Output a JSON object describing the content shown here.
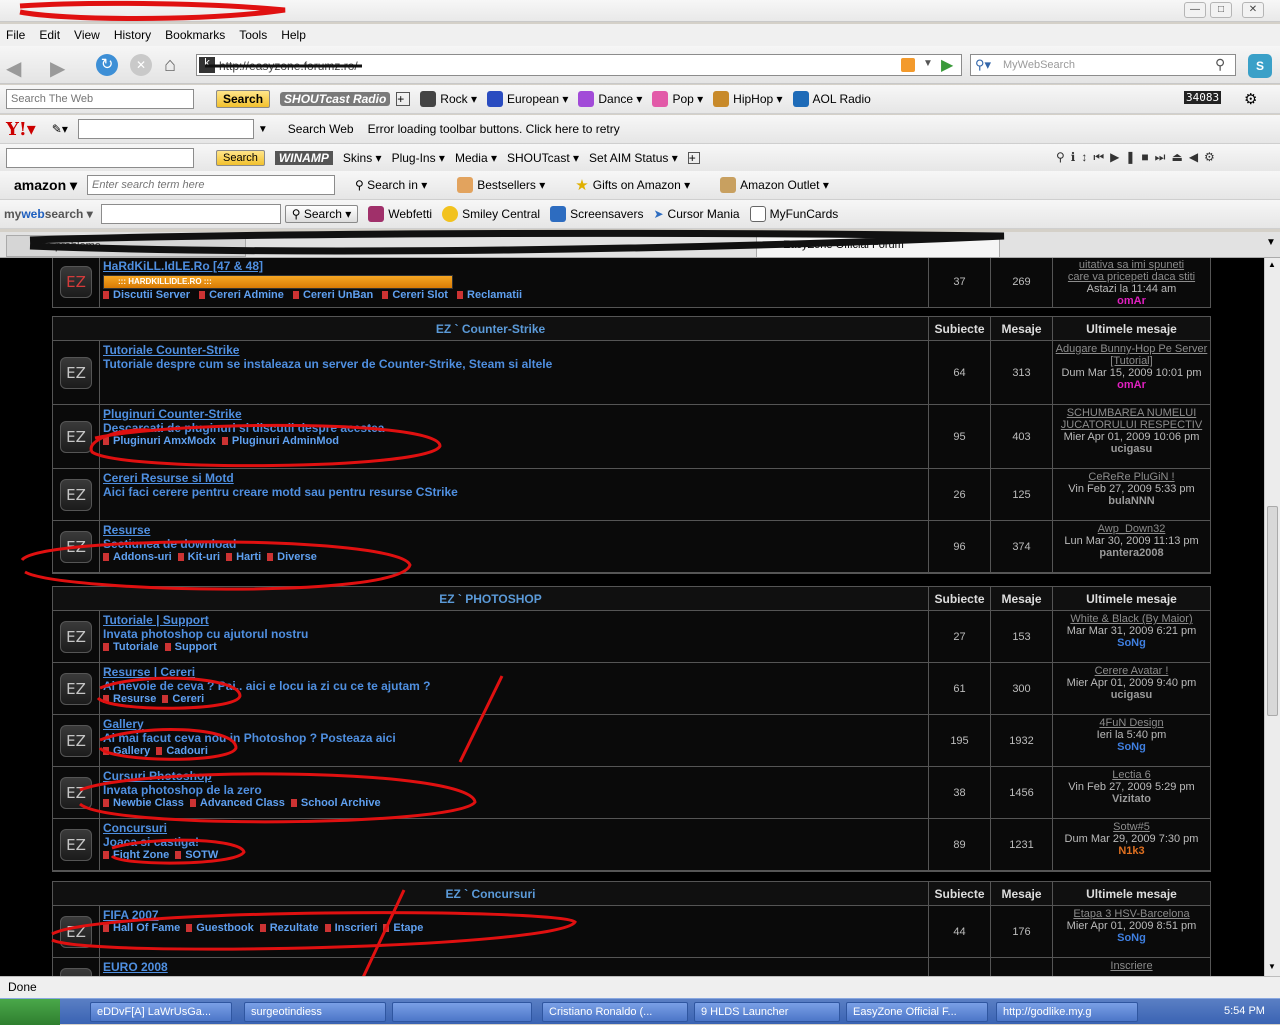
{
  "menu": [
    "File",
    "Edit",
    "View",
    "History",
    "Bookmarks",
    "Tools",
    "Help"
  ],
  "nav": {
    "url": "http://easyzone.forumz.ro/",
    "search_placeholder": "MyWebSearch"
  },
  "ask_toolbar": {
    "placeholder": "Search The Web",
    "search": "Search",
    "shoutcast": "SHOUTcast Radio",
    "items": [
      "Rock",
      "European",
      "Dance",
      "Pop",
      "HipHop",
      "AOL Radio"
    ],
    "counter": "34083"
  },
  "yahoo_toolbar": {
    "search_web": "Search Web",
    "error": "Error loading toolbar buttons. Click here to retry"
  },
  "winamp_toolbar": {
    "search": "Search",
    "items": [
      "Skins",
      "Plug-Ins",
      "Media",
      "SHOUTcast",
      "Set AIM Status"
    ]
  },
  "amazon_toolbar": {
    "placeholder": "Enter search term here",
    "search_in": "Search in",
    "bestsellers": "Bestsellers",
    "gifts": "Gifts on Amazon",
    "outlet": "Amazon Outlet"
  },
  "mws_toolbar": {
    "search": "Search",
    "items": [
      "Webfetti",
      "Smiley Central",
      "Screensavers",
      "Cursor Mania",
      "MyFunCards"
    ]
  },
  "tabs": [
    "Alte probleme",
    "EasyZone Official Forum"
  ],
  "top_row": {
    "title": "HaRdKiLL.IdLE.Ro [47 & 48]",
    "banner": "::: HARDKILLIDLE.RO :::",
    "subs": [
      "Discutii Server",
      "Cereri Admine",
      "Cereri UnBan",
      "Cereri Slot",
      "Reclamatii"
    ],
    "topics": "37",
    "posts": "269",
    "last": {
      "t1": "uitativa sa imi spuneti",
      "t2": "care va pricepeti daca stiti",
      "date": "Astazi la 11:44 am",
      "user": "omAr"
    }
  },
  "headers": {
    "topics": "Subiecte",
    "posts": "Mesaje",
    "last": "Ultimele mesaje"
  },
  "categories": [
    {
      "name": "EZ ` Counter-Strike",
      "forums": [
        {
          "title": "Tutoriale Counter-Strike",
          "desc": "Tutoriale despre cum se instaleaza un server de Counter-Strike, Steam si altele",
          "subs": [],
          "topics": "64",
          "posts": "313",
          "last_title": "Adugare Bunny-Hop Pe Server [Tutorial]",
          "last_date": "Dum Mar 15, 2009 10:01 pm",
          "last_user": "omAr",
          "user_color": "#e020c0"
        },
        {
          "title": "Pluginuri Counter-Strike",
          "desc": "Descarcati de pluginuri si discutii despre acestea",
          "subs": [
            "Pluginuri AmxModx",
            "Pluginuri AdminMod"
          ],
          "topics": "95",
          "posts": "403",
          "last_title": "SCHUMBAREA NUMELUI JUCATORULUI RESPECTIV",
          "last_date": "Mier Apr 01, 2009 10:06 pm",
          "last_user": "ucigasu",
          "user_color": "#9a9a9a"
        },
        {
          "title": "Cereri Resurse si Motd",
          "desc": "Aici faci cerere pentru creare motd sau pentru resurse CStrike",
          "subs": [],
          "topics": "26",
          "posts": "125",
          "last_title": "CeReRe PluGiN !",
          "last_date": "Vin Feb 27, 2009 5:33 pm",
          "last_user": "bulaNNN",
          "user_color": "#9a9a9a"
        },
        {
          "title": "Resurse",
          "desc": "Sectiunea de download",
          "subs": [
            "Addons-uri",
            "Kit-uri",
            "Harti",
            "Diverse"
          ],
          "topics": "96",
          "posts": "374",
          "last_title": "Awp_Down32",
          "last_date": "Lun Mar 30, 2009 11:13 pm",
          "last_user": "pantera2008",
          "user_color": "#9a9a9a"
        }
      ]
    },
    {
      "name": "EZ ` PHOTOSHOP",
      "forums": [
        {
          "title": "Tutoriale | Support",
          "desc": "Invata photoshop cu ajutorul nostru",
          "subs": [
            "Tutoriale",
            "Support"
          ],
          "topics": "27",
          "posts": "153",
          "last_title": "White & Black (By Maior)",
          "last_date": "Mar Mar 31, 2009 6:21 pm",
          "last_user": "SoNg",
          "user_color": "#3f7fe0"
        },
        {
          "title": "Resurse | Cereri",
          "desc": "Ai nevoie de ceva ? Pai.. aici e locu ia zi cu ce te ajutam ?",
          "subs": [
            "Resurse",
            "Cereri"
          ],
          "topics": "61",
          "posts": "300",
          "last_title": "Cerere Avatar !",
          "last_date": "Mier Apr 01, 2009 9:40 pm",
          "last_user": "ucigasu",
          "user_color": "#9a9a9a"
        },
        {
          "title": "Gallery",
          "desc": "Ai mai facut ceva nou in Photoshop ? Posteaza aici",
          "subs": [
            "Gallery",
            "Cadouri"
          ],
          "topics": "195",
          "posts": "1932",
          "last_title": "4FuN Design",
          "last_date": "Ieri la 5:40 pm",
          "last_user": "SoNg",
          "user_color": "#3f7fe0"
        },
        {
          "title": "Cursuri Photoshop",
          "desc": "Invata photoshop de la zero",
          "subs": [
            "Newbie Class",
            "Advanced Class",
            "School Archive"
          ],
          "topics": "38",
          "posts": "1456",
          "last_title": "Lectia 6",
          "last_date": "Vin Feb 27, 2009 5:29 pm",
          "last_user": "Vizitato",
          "user_color": "#9a9a9a"
        },
        {
          "title": "Concursuri",
          "desc": "Joaca si castiga!",
          "subs": [
            "Fight Zone",
            "SOTW"
          ],
          "topics": "89",
          "posts": "1231",
          "last_title": "Sotw#5",
          "last_date": "Dum Mar 29, 2009 7:30 pm",
          "last_user": "N1k3",
          "user_color": "#e07020"
        }
      ]
    },
    {
      "name": "EZ ` Concursuri",
      "forums": [
        {
          "title": "FIFA 2007",
          "desc": "",
          "subs": [
            "Hall Of Fame",
            "Guestbook",
            "Rezultate",
            "Inscrieri",
            "Etape"
          ],
          "topics": "44",
          "posts": "176",
          "last_title": "Etapa 3 HSV-Barcelona",
          "last_date": "Mier Apr 01, 2009 8:51 pm",
          "last_user": "SoNg",
          "user_color": "#3f7fe0"
        },
        {
          "title": "EURO 2008",
          "desc": "",
          "subs": [],
          "topics": "",
          "posts": "",
          "last_title": "Inscriere",
          "last_date": "",
          "last_user": "",
          "user_color": "#9a9a9a"
        }
      ]
    }
  ],
  "status": "Done",
  "taskbar": [
    "eDDvF[A] LaWrUsGa...",
    "surgeotindiess",
    "Cristiano Ronaldo (...",
    "9 HLDS Launcher",
    "EasyZone Official F...",
    "http://godlike.my.g"
  ],
  "clock": "5:54 PM"
}
